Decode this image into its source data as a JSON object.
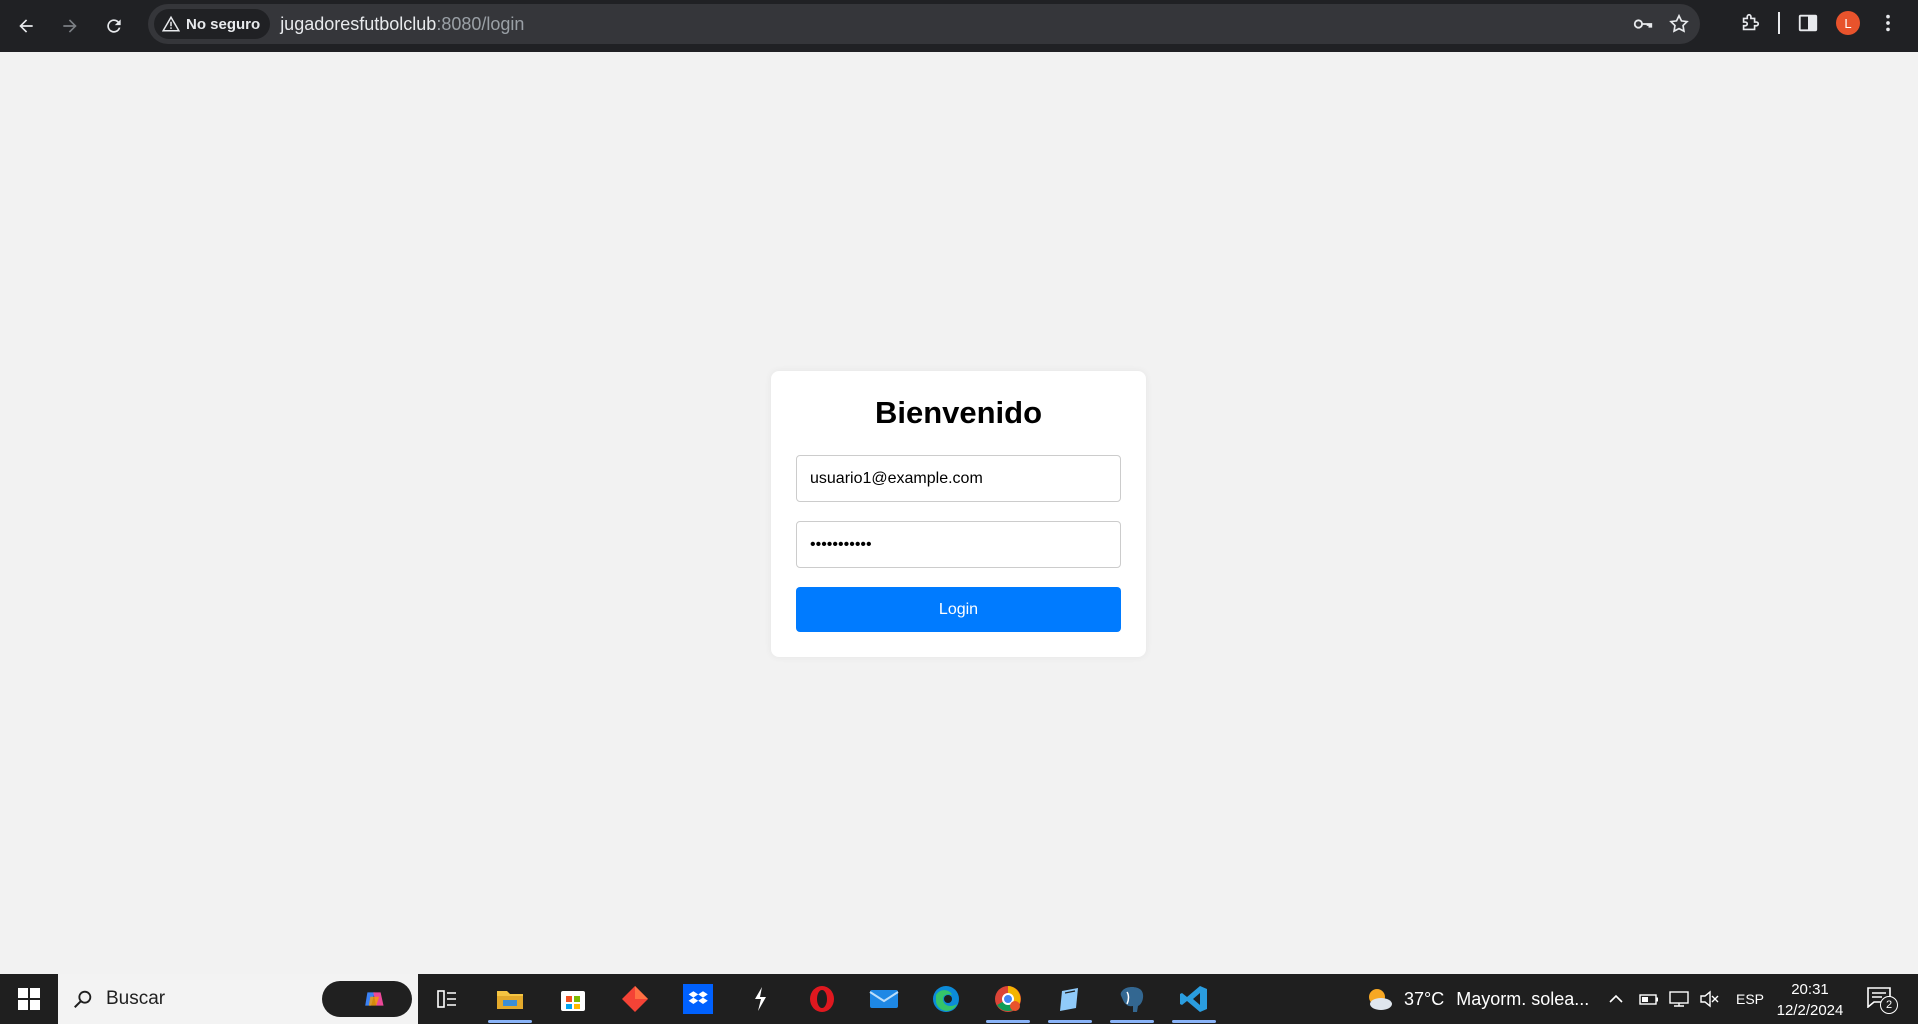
{
  "browser": {
    "security_label": "No seguro",
    "url_host": "jugadoresfutbolclub",
    "url_rest": ":8080/login",
    "profile_initial": "L"
  },
  "login": {
    "title": "Bienvenido",
    "email_value": "usuario1@example.com",
    "password_value": "usuario1234",
    "button_label": "Login"
  },
  "taskbar": {
    "search_placeholder": "Buscar",
    "weather_temp": "37°C",
    "weather_desc": "Mayorm. solea...",
    "language": "ESP",
    "time": "20:31",
    "date": "12/2/2024",
    "notification_count": "2"
  },
  "colors": {
    "primary_button": "#007bff",
    "page_bg": "#f2f2f2",
    "chrome_bg": "#202124"
  }
}
